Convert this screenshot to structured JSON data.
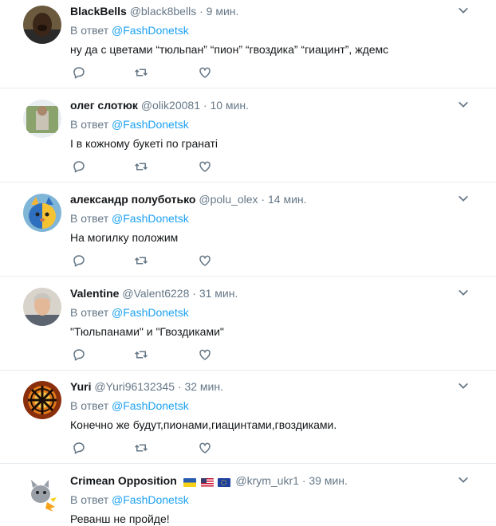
{
  "tweets": [
    {
      "name": "BlackBells",
      "handle": "@black8bells",
      "time": "9 мин.",
      "reply_prefix": "В ответ",
      "reply_to": "@FashDonetsk",
      "text": "ну да с цветами “тюльпан” “пион” “гвоздика” “гиацинт”, ждемс",
      "avatar_icon": "avatar-photo-icon"
    },
    {
      "name": "олег слотюк",
      "handle": "@olik20081",
      "time": "10 мин.",
      "reply_prefix": "В ответ",
      "reply_to": "@FashDonetsk",
      "text": "І в кожному букеті по гранаті",
      "avatar_icon": "avatar-photo-icon"
    },
    {
      "name": "александр полуботько",
      "handle": "@polu_olex",
      "time": "14 мин.",
      "reply_prefix": "В ответ",
      "reply_to": "@FashDonetsk",
      "text": "На могилку положим",
      "avatar_icon": "avatar-cat-icon"
    },
    {
      "name": "Valentine",
      "handle": "@Valent6228",
      "time": "31 мин.",
      "reply_prefix": "В ответ",
      "reply_to": "@FashDonetsk",
      "text": "\"Тюльпанами\" и \"Гвоздиками\"",
      "avatar_icon": "avatar-photo-icon"
    },
    {
      "name": "Yuri",
      "handle": "@Yuri96132345",
      "time": "32 мин.",
      "reply_prefix": "В ответ",
      "reply_to": "@FashDonetsk",
      "text": "Конечно же будут,пионами,гиацинтами,гвоздиками.",
      "avatar_icon": "avatar-sun-symbol-icon"
    },
    {
      "name": "Crimean Opposition",
      "handle": "@krym_ukr1",
      "time": "39 мин.",
      "reply_prefix": "В ответ",
      "reply_to": "@FashDonetsk",
      "text": "Реванш не пройде!",
      "avatar_icon": "avatar-cartoon-icon",
      "flags": [
        "flag-ukraine-icon",
        "flag-usa-icon",
        "flag-eu-icon"
      ]
    }
  ],
  "separator": "·",
  "icons": {
    "reply": "reply-icon",
    "retweet": "retweet-icon",
    "like": "heart-icon",
    "menu": "chevron-down-icon"
  },
  "colors": {
    "link": "#1da1f2",
    "muted": "#657786",
    "text": "#14171a",
    "border": "#e6ecf0",
    "ukraine_blue": "#2a5db0",
    "ukraine_yellow": "#f7d117",
    "eu_blue": "#1c3fa0"
  }
}
